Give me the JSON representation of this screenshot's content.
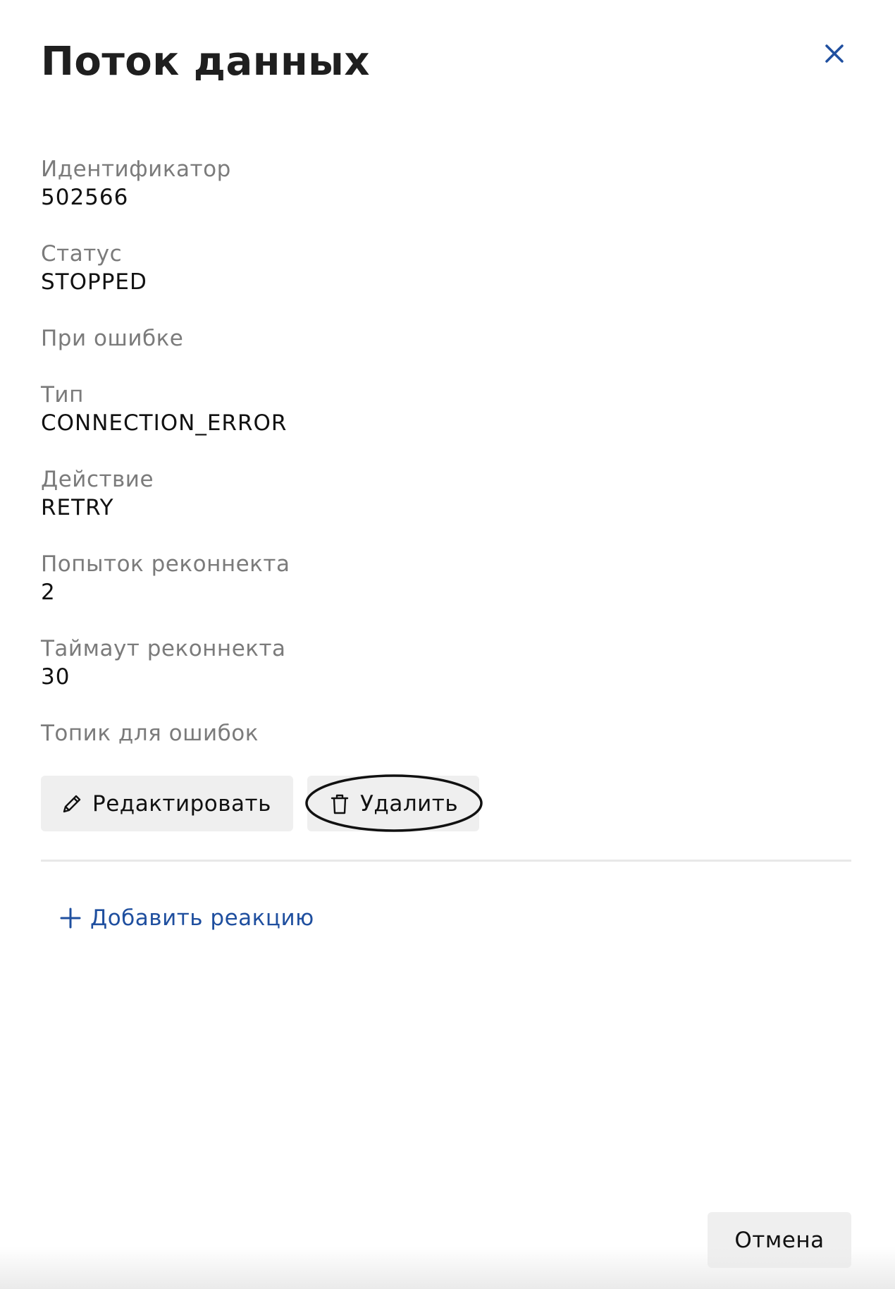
{
  "dialog": {
    "title": "Поток данных",
    "close_icon": "close-icon"
  },
  "fields": {
    "id": {
      "label": "Идентификатор",
      "value": "502566"
    },
    "status": {
      "label": "Статус",
      "value": "STOPPED"
    },
    "on_error": {
      "label": "При ошибке"
    },
    "type": {
      "label": "Тип",
      "value": "CONNECTION_ERROR"
    },
    "action": {
      "label": "Действие",
      "value": "RETRY"
    },
    "reconnect_attempts": {
      "label": "Попыток реконнекта",
      "value": "2"
    },
    "reconnect_timeout": {
      "label": "Таймаут реконнекта",
      "value": "30"
    },
    "error_topic": {
      "label": "Топик для ошибок"
    }
  },
  "actions": {
    "edit_label": "Редактировать",
    "edit_icon": "pencil-icon",
    "delete_label": "Удалить",
    "delete_icon": "trash-icon"
  },
  "reactions": {
    "add_label": "Добавить реакцию",
    "add_icon": "plus-icon"
  },
  "footer": {
    "cancel_label": "Отмена"
  },
  "colors": {
    "accent": "#1f4f9f",
    "label": "#7b7b7b",
    "text": "#111111",
    "button_bg": "#efefef"
  }
}
